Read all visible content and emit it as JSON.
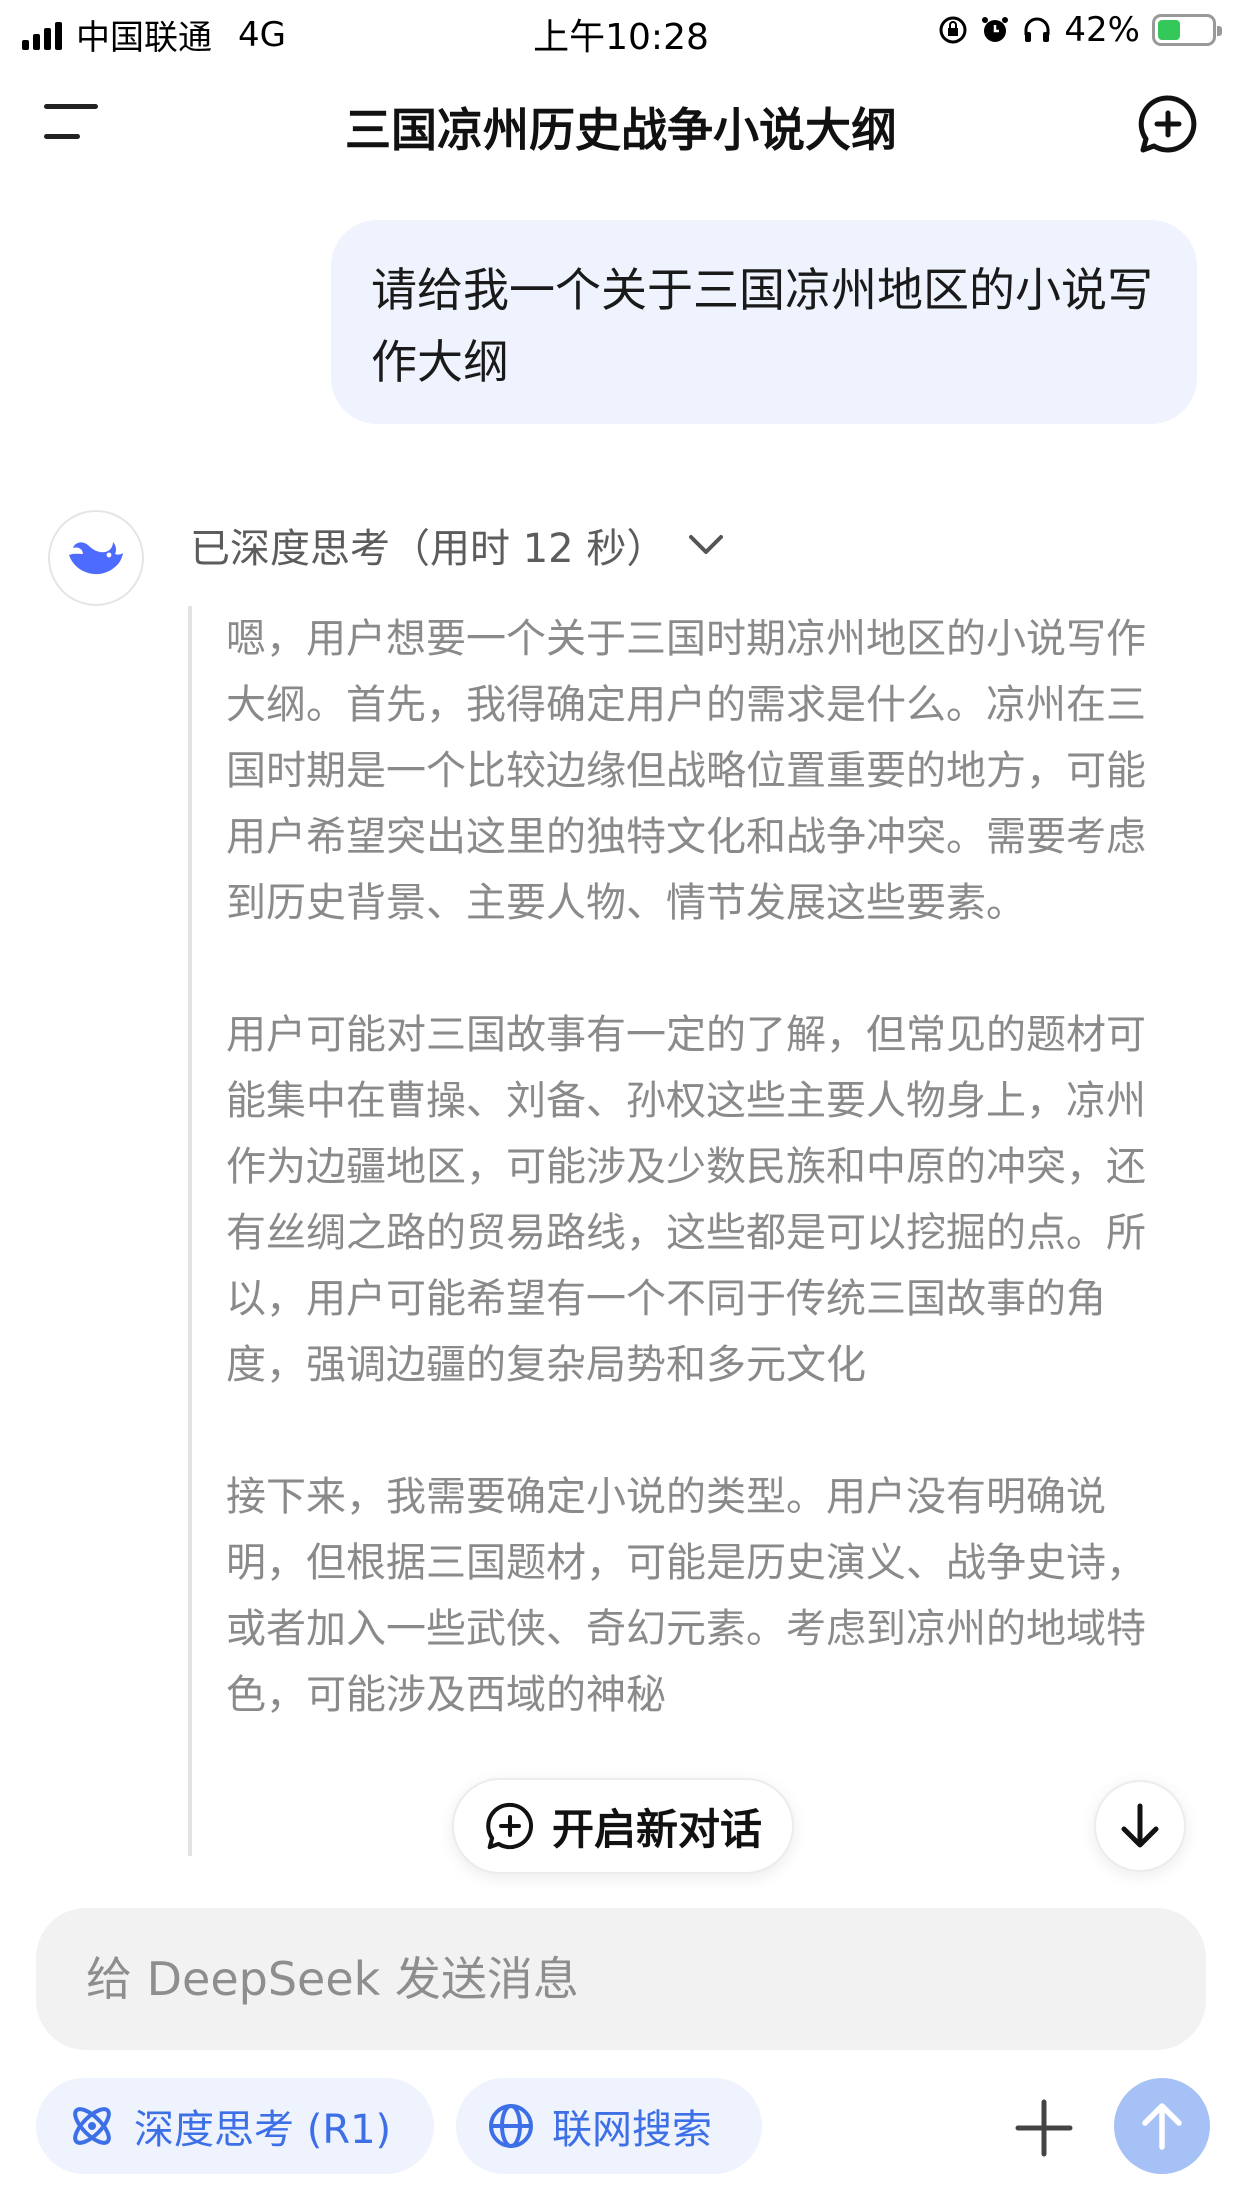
{
  "status_bar": {
    "carrier": "中国联通",
    "network": "4G",
    "time": "上午10:28",
    "battery": "42%",
    "battery_level": 0.42
  },
  "header": {
    "title": "三国凉州历史战争小说大纲",
    "menu_icon": "hamburger-icon",
    "new_chat_icon": "chat-plus-icon"
  },
  "user_message": {
    "text": "请给我一个关于三国凉州地区的小说写作大纲"
  },
  "assistant": {
    "avatar_icon": "deepseek-whale-icon",
    "thinking_label": "已深度思考（用时 12 秒）",
    "thinking_paragraphs": [
      "嗯，用户想要一个关于三国时期凉州地区的小说写作大纲。首先，我得确定用户的需求是什么。凉州在三国时期是一个比较边缘但战略位置重要的地方，可能用户希望突出这里的独特文化和战争冲突。需要考虑到历史背景、主要人物、情节发展这些要素。",
      "用户可能对三国故事有一定的了解，但常见的题材可能集中在曹操、刘备、孙权这些主要人物身上，凉州作为边疆地区，可能涉及少数民族和中原的冲突，还有丝绸之路的贸易路线，这些都是可以挖掘的点。所以，用户可能希望有一个不同于传统三国故事的角度，强调边疆的复杂局势和多元文化",
      "接下来，我需要确定小说的类型。用户没有明确说明，但根据三国题材，可能是历史演义、战争史诗，或者加入一些武侠、奇幻元素。考虑到凉州的地域特色，可能涉及西域的神秘"
    ]
  },
  "floating": {
    "new_conversation_label": "开启新对话"
  },
  "composer": {
    "placeholder": "给 DeepSeek 发送消息",
    "deep_think_label": "深度思考 (R1)",
    "web_search_label": "联网搜索"
  },
  "colors": {
    "accent": "#3d6fe6",
    "bubble": "#eef3fd",
    "send_disabled": "#a6c1f5"
  }
}
